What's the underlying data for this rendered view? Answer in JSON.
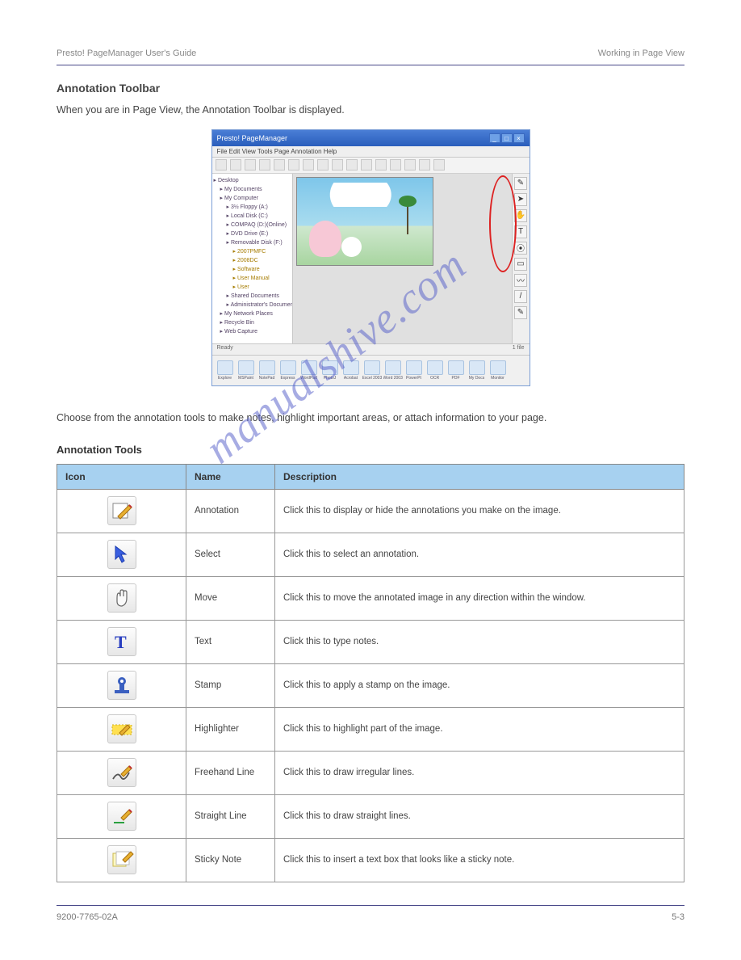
{
  "header": {
    "product": "Presto! PageManager User's Guide",
    "chapter": "Working in Page View"
  },
  "intro": {
    "title": "Annotation Toolbar",
    "text": "When you are in Page View, the Annotation Toolbar is displayed."
  },
  "screenshot": {
    "window_title": "Presto! PageManager",
    "menu": "File  Edit  View  Tools  Page  Annotation  Help",
    "tree": [
      {
        "t": "Desktop",
        "cls": ""
      },
      {
        "t": "My Documents",
        "cls": "ind1"
      },
      {
        "t": "My Computer",
        "cls": "ind1"
      },
      {
        "t": "3½ Floppy (A:)",
        "cls": "ind2"
      },
      {
        "t": "Local Disk (C:)",
        "cls": "ind2"
      },
      {
        "t": "COMPAQ (D:)(Online)",
        "cls": "ind2"
      },
      {
        "t": "DVD Drive (E:)",
        "cls": "ind2"
      },
      {
        "t": "Removable Disk (F:)",
        "cls": "ind2"
      },
      {
        "t": "2007PMFC",
        "cls": "ind3 f"
      },
      {
        "t": "2008DC",
        "cls": "ind3 f"
      },
      {
        "t": "Software",
        "cls": "ind3 f"
      },
      {
        "t": "User Manual",
        "cls": "ind3 f"
      },
      {
        "t": "User",
        "cls": "ind3 f"
      },
      {
        "t": "Shared Documents",
        "cls": "ind2"
      },
      {
        "t": "Administrator's Documents",
        "cls": "ind2"
      },
      {
        "t": "My Network Places",
        "cls": "ind1"
      },
      {
        "t": "Recycle Bin",
        "cls": "ind1"
      },
      {
        "t": "Web Capture",
        "cls": "ind1"
      }
    ],
    "annotation_icons": [
      "✎",
      "➤",
      "✋",
      "T",
      "⦿",
      "▭",
      "〰",
      "/",
      "✎"
    ],
    "status_left": "Ready",
    "status_right": "1 file",
    "appbar": [
      "Explore",
      "MSPaint",
      "NotePad",
      "Express",
      "WordPad",
      "PhotoJ",
      "Acrobat",
      "Excel 2003",
      "Word 2003",
      "PowerPt",
      "OCR",
      "PDF",
      "My Docs",
      "Monitor"
    ]
  },
  "watermark": "manualshive.com",
  "subsection": {
    "text": "Choose from the annotation tools to make notes, highlight important areas, or attach information to your page.",
    "title": "Annotation Tools"
  },
  "table": {
    "headers": {
      "icon": "Icon",
      "name": "Name",
      "desc": "Description"
    },
    "rows": [
      {
        "icon": "annotate",
        "name": "Annotation",
        "desc": "Click this to display or hide the annotations you make on the image."
      },
      {
        "icon": "arrow",
        "name": "Select",
        "desc": "Click this to select an annotation."
      },
      {
        "icon": "hand",
        "name": "Move",
        "desc": "Click this to move the annotated image in any direction within the window."
      },
      {
        "icon": "text",
        "name": "Text",
        "desc": "Click this to type notes."
      },
      {
        "icon": "stamp",
        "name": "Stamp",
        "desc": "Click this to apply a stamp on the image."
      },
      {
        "icon": "hilite",
        "name": "Highlighter",
        "desc": "Click this to highlight part of the image."
      },
      {
        "icon": "freeline",
        "name": "Freehand Line",
        "desc": "Click this to draw irregular lines."
      },
      {
        "icon": "sline",
        "name": "Straight Line",
        "desc": "Click this to draw straight lines."
      },
      {
        "icon": "sticky",
        "name": "Sticky Note",
        "desc": "Click this to insert a text box that looks like a sticky note."
      }
    ]
  },
  "footer": {
    "left": "9200-7765-02A",
    "right": "5-3"
  }
}
